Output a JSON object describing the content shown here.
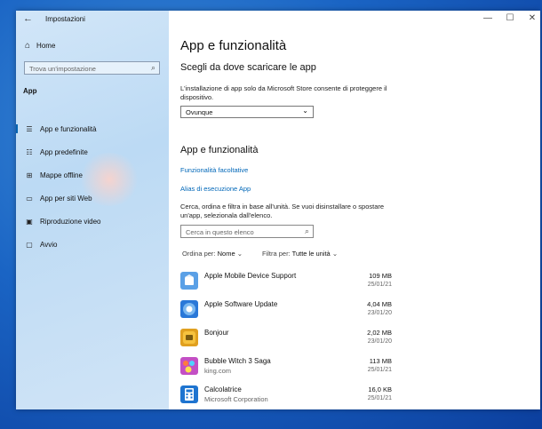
{
  "window": {
    "title": "Impostazioni",
    "back_icon": "←",
    "minimize": "—",
    "maximize": "☐",
    "close": "✕"
  },
  "sidebar": {
    "home_label": "Home",
    "home_icon": "⌂",
    "search_placeholder": "Trova un'impostazione",
    "section_label": "App",
    "items": [
      {
        "label": "App e funzionalità",
        "icon": "☰",
        "active": true
      },
      {
        "label": "App predefinite",
        "icon": "☷"
      },
      {
        "label": "Mappe offline",
        "icon": "⊞"
      },
      {
        "label": "App per siti Web",
        "icon": "▭"
      },
      {
        "label": "Riproduzione video",
        "icon": "▣"
      },
      {
        "label": "Avvio",
        "icon": "▢"
      }
    ]
  },
  "main": {
    "page_title": "App e funzionalità",
    "source_heading": "Scegli da dove scaricare le app",
    "source_description": "L'installazione di app solo da Microsoft Store consente di proteggere il dispositivo.",
    "source_dropdown_value": "Ovunque",
    "apps_heading": "App e funzionalità",
    "link_optional": "Funzionalità facoltative",
    "link_alias": "Alias di esecuzione App",
    "list_description": "Cerca, ordina e filtra in base all'unità. Se vuoi disinstallare o spostare un'app, selezionala dall'elenco.",
    "list_search_placeholder": "Cerca in questo elenco",
    "sort_label": "Ordina per:",
    "sort_value": "Nome",
    "filter_label": "Filtra per:",
    "filter_value": "Tutte le unità",
    "apps": [
      {
        "name": "Apple Mobile Device Support",
        "publisher": "",
        "size": "109 MB",
        "date": "25/01/21",
        "icon_color": "#5aa0e6"
      },
      {
        "name": "Apple Software Update",
        "publisher": "",
        "size": "4,04 MB",
        "date": "23/01/20",
        "icon_color": "#2a78d8"
      },
      {
        "name": "Bonjour",
        "publisher": "",
        "size": "2,02 MB",
        "date": "23/01/20",
        "icon_color": "#e0a020"
      },
      {
        "name": "Bubble Witch 3 Saga",
        "publisher": "king.com",
        "size": "113 MB",
        "date": "25/01/21",
        "icon_color": "#c34fc4"
      },
      {
        "name": "Calcolatrice",
        "publisher": "Microsoft Corporation",
        "size": "16,0 KB",
        "date": "25/01/21",
        "icon_color": "#1e74d0"
      }
    ]
  }
}
